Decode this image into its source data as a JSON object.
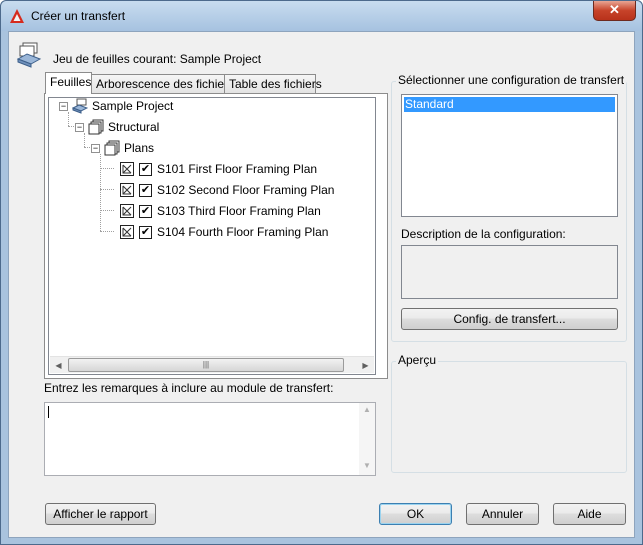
{
  "window": {
    "title": "Créer un transfert",
    "close_label": "✕"
  },
  "header": {
    "label": "Jeu de feuilles courant: Sample Project"
  },
  "tabs": [
    {
      "label": "Feuilles",
      "active": true
    },
    {
      "label": "Arborescence des fichiers",
      "active": false
    },
    {
      "label": "Table des fichiers",
      "active": false
    }
  ],
  "tree": {
    "root": "Sample Project",
    "subset1": "Structural",
    "subset2": "Plans",
    "sheets": [
      {
        "label": "S101 First Floor Framing Plan",
        "checked": true
      },
      {
        "label": "S102 Second Floor Framing Plan",
        "checked": true
      },
      {
        "label": "S103 Third Floor Framing Plan",
        "checked": true
      },
      {
        "label": "S104 Fourth Floor Framing Plan",
        "checked": true
      }
    ]
  },
  "remarks": {
    "label": "Entrez les remarques à inclure au module de transfert:",
    "value": ""
  },
  "config": {
    "group_label": "Sélectionner une configuration de transfert",
    "selected": "Standard",
    "description_label": "Description de la configuration:",
    "description_value": "",
    "button_label": "Config. de transfert..."
  },
  "preview": {
    "group_label": "Aperçu"
  },
  "buttons": {
    "report": "Afficher le rapport",
    "ok": "OK",
    "cancel": "Annuler",
    "help": "Aide"
  },
  "colors": {
    "selection": "#3399ff",
    "title_bar": "#a9c3de",
    "close_button": "#c7432a"
  }
}
